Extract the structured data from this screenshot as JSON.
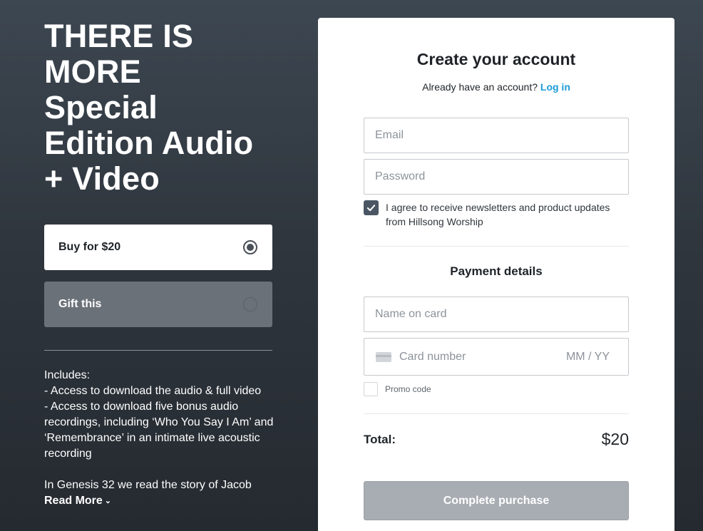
{
  "hero": {
    "title_line1": "THERE IS",
    "title_line2": "MORE",
    "title_line3": "Special",
    "title_line4": "Edition Audio",
    "title_line5": "+ Video"
  },
  "purchase_options": {
    "buy_label": "Buy for $20",
    "gift_label": "Gift this",
    "selected": "buy"
  },
  "description": {
    "includes": "Includes:",
    "item1": "- Access to download the audio & full video",
    "item2": "- Access to download five bonus audio recordings, including ‘Who You Say I Am’ and ‘Remembrance’ in an intimate live acoustic recording",
    "teaser": "In Genesis 32 we read the story of Jacob",
    "read_more": "Read More"
  },
  "account": {
    "title": "Create your account",
    "already": "Already have an account?",
    "login_link": "Log in",
    "email_placeholder": "Email",
    "password_placeholder": "Password",
    "agree_text": "I agree to receive newsletters and product updates from Hillsong Worship",
    "agree_checked": true
  },
  "payment": {
    "title": "Payment details",
    "name_placeholder": "Name on card",
    "card_placeholder": "Card number",
    "expiry_placeholder": "MM / YY",
    "promo_label": "Promo code",
    "total_label": "Total:",
    "total_value": "$20",
    "submit_label": "Complete purchase"
  },
  "colors": {
    "link": "#1d9bd7",
    "button_disabled": "#a8adb3",
    "checkbox": "#4a5663"
  }
}
